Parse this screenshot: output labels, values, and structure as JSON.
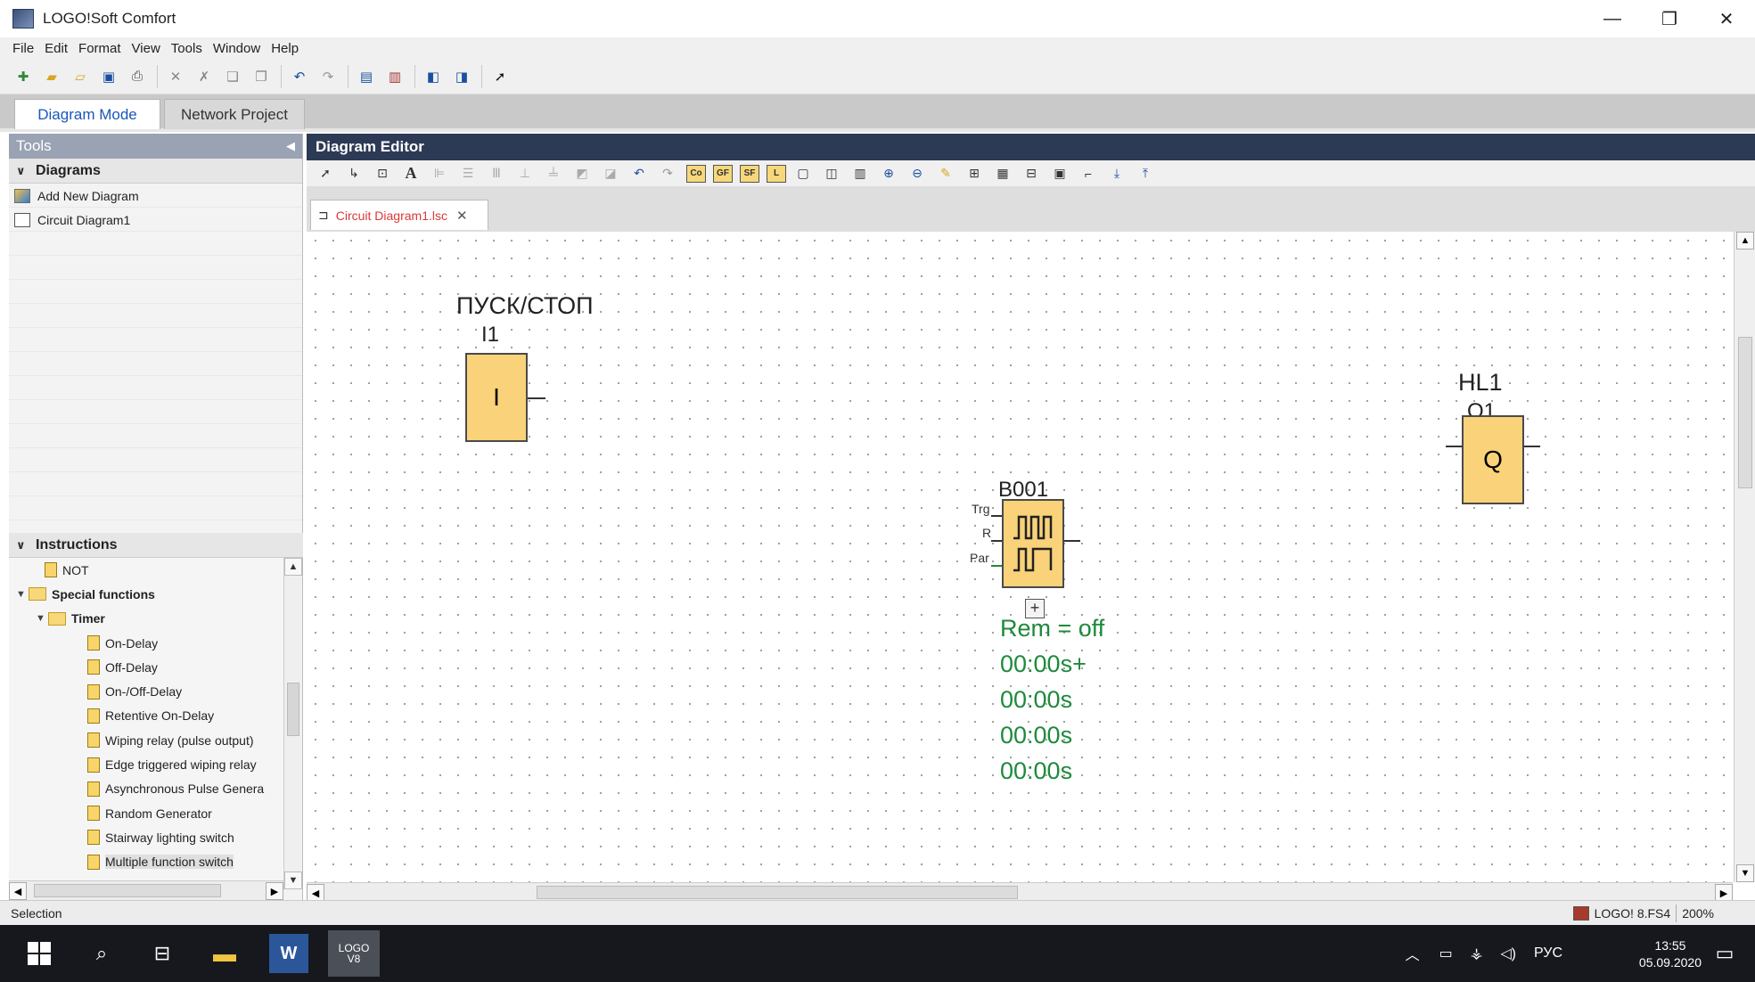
{
  "window": {
    "title": "LOGO!Soft Comfort",
    "minimize": "—",
    "restore": "❐",
    "close": "✕"
  },
  "menu": [
    "File",
    "Edit",
    "Format",
    "View",
    "Tools",
    "Window",
    "Help"
  ],
  "mode_tabs": {
    "diagram": "Diagram Mode",
    "network": "Network Project"
  },
  "tools_panel": {
    "header": "Tools",
    "diagrams_section": "Diagrams",
    "diagram_items": [
      "Add New Diagram",
      "Circuit Diagram1"
    ],
    "instructions_section": "Instructions",
    "instructions": [
      {
        "label": "NOT",
        "kind": "leaf",
        "level": 1
      },
      {
        "label": "Special functions",
        "kind": "folder",
        "level": 0,
        "expanded": true
      },
      {
        "label": "Timer",
        "kind": "folder",
        "level": 1,
        "expanded": true
      },
      {
        "label": "On-Delay",
        "kind": "leaf",
        "level": 2
      },
      {
        "label": "Off-Delay",
        "kind": "leaf",
        "level": 2
      },
      {
        "label": "On-/Off-Delay",
        "kind": "leaf",
        "level": 2
      },
      {
        "label": "Retentive On-Delay",
        "kind": "leaf",
        "level": 2
      },
      {
        "label": "Wiping relay (pulse output)",
        "kind": "leaf",
        "level": 2
      },
      {
        "label": "Edge triggered wiping relay",
        "kind": "leaf",
        "level": 2
      },
      {
        "label": "Asynchronous Pulse Genera",
        "kind": "leaf",
        "level": 2
      },
      {
        "label": "Random Generator",
        "kind": "leaf",
        "level": 2
      },
      {
        "label": "Stairway lighting switch",
        "kind": "leaf",
        "level": 2
      },
      {
        "label": "Multiple function switch",
        "kind": "leaf",
        "level": 2,
        "selected": true
      }
    ]
  },
  "editor": {
    "header": "Diagram Editor",
    "tab_label": "Circuit Diagram1.lsc",
    "tab_close": "✕",
    "toolbar_boxes": [
      "Co",
      "GF",
      "SF",
      "L"
    ]
  },
  "diagram": {
    "input_block": {
      "comment": "ПУСК/СТОП",
      "name": "I1",
      "symbol": "I"
    },
    "output_block": {
      "comment": "HL1",
      "name": "Q1",
      "symbol": "Q"
    },
    "function_block": {
      "name": "B001",
      "pins": [
        "Trg",
        "R",
        "Par"
      ],
      "expand": "+",
      "parameters": [
        "Rem = off",
        "00:00s+",
        "00:00s",
        "00:00s",
        "00:00s"
      ]
    }
  },
  "statusbar": {
    "left": "Selection",
    "device": "LOGO! 8.FS4",
    "zoom": "200%"
  },
  "taskbar": {
    "logo_label": "LOGO\nV8",
    "word_label": "W",
    "tray_lang": "РУС",
    "time": "13:55",
    "date": "05.09.2020"
  },
  "colors": {
    "block_fill": "#f9d27a",
    "param_text": "#1e8a3c",
    "editor_header": "#2d3a55",
    "tab_text": "#d83a3a"
  }
}
